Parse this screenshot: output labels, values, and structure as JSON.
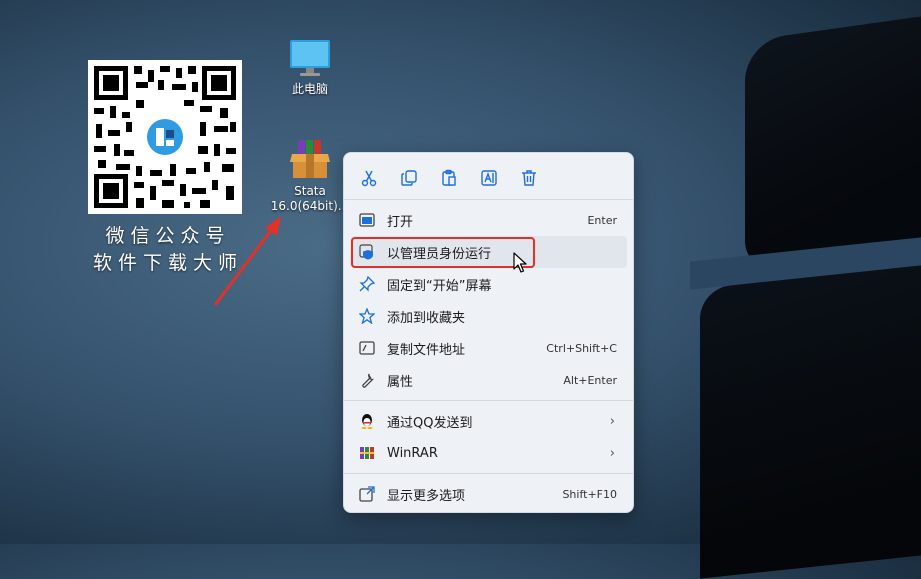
{
  "desktop": {
    "icons": [
      {
        "label": "此电脑"
      },
      {
        "label_line1": "Stata",
        "label_line2": "16.0(64bit)..."
      }
    ],
    "qr_caption_line1": "微信公众号",
    "qr_caption_line2": "软件下载大师"
  },
  "context_menu": {
    "toolbar": [
      "cut-icon",
      "copy-icon",
      "paste-icon",
      "rename-icon",
      "delete-icon"
    ],
    "items": [
      {
        "label": "打开",
        "shortcut": "Enter",
        "icon": "open-icon"
      },
      {
        "label": "以管理员身份运行",
        "shortcut": "",
        "icon": "shield-icon",
        "highlighted": true
      },
      {
        "label": "固定到“开始”屏幕",
        "shortcut": "",
        "icon": "pin-icon"
      },
      {
        "label": "添加到收藏夹",
        "shortcut": "",
        "icon": "star-icon"
      },
      {
        "label": "复制文件地址",
        "shortcut": "Ctrl+Shift+C",
        "icon": "copy-path-icon"
      },
      {
        "label": "属性",
        "shortcut": "Alt+Enter",
        "icon": "wrench-icon"
      },
      {
        "label": "通过QQ发送到",
        "shortcut": "",
        "icon": "qq-icon",
        "submenu": true
      },
      {
        "label": "WinRAR",
        "shortcut": "",
        "icon": "winrar-icon",
        "submenu": true
      },
      {
        "label": "显示更多选项",
        "shortcut": "Shift+F10",
        "icon": "more-options-icon"
      }
    ]
  },
  "colors": {
    "highlight_border": "#e0322a",
    "accent": "#1e6fd9"
  }
}
